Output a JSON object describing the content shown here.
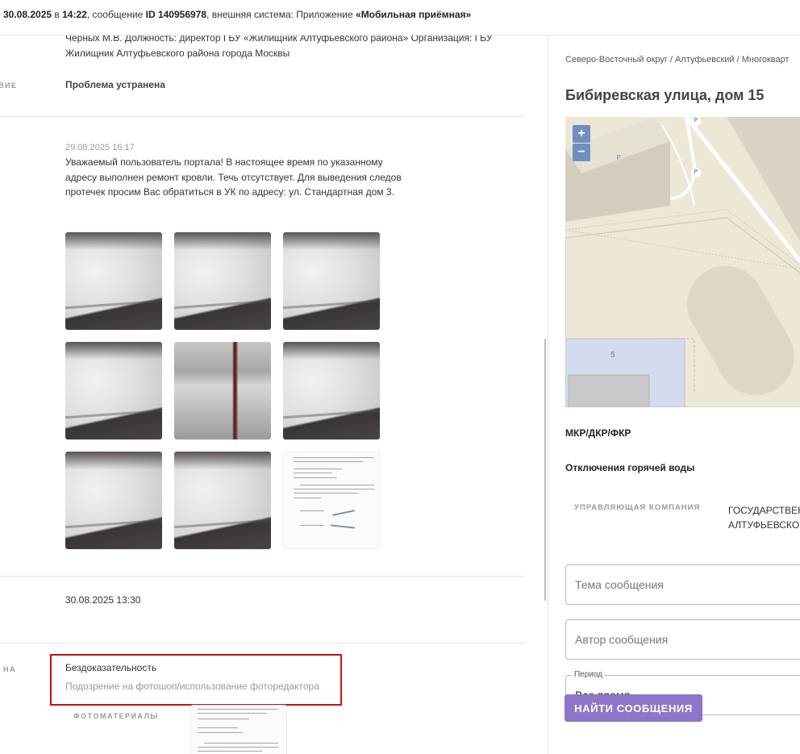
{
  "header": {
    "date": "30.08.2025",
    "in_word": "в",
    "time": "14:22",
    "message_prefix": ", сообщение",
    "id_label": "ID 140956978",
    "system_text": ", внешняя система: Приложение",
    "system_name": "«Мобильная приёмная»"
  },
  "left": {
    "responsible_text": "Черных М.В. Должность: директор ГБУ «Жилищник Алтуфьевского района» Организация: ГБУ Жилищник Алтуфьевского района города Москвы",
    "state_label": "ВИЕ",
    "state_value": "Проблема устранена",
    "answer_datetime": "29.08.2025 16:17",
    "answer_text": "Уважаемый пользователь портала! В настоящее время по указанному адресу выполнен ремонт кровли. Течь отсутствует. Для выведения следов протечек просим Вас обратиться в УК по адресу: ул. Стандартная дом 3.",
    "photos": [
      {
        "kind": "snow"
      },
      {
        "kind": "snow"
      },
      {
        "kind": "snow"
      },
      {
        "kind": "snow"
      },
      {
        "kind": "tower"
      },
      {
        "kind": "snow"
      },
      {
        "kind": "snow"
      },
      {
        "kind": "snow"
      },
      {
        "kind": "document"
      }
    ],
    "second_datetime": "30.08.2025 13:30",
    "reason_label": "НА",
    "reason_title": "Бездоказательность",
    "reason_detail": "Подозрение на фотошоп/использование фоторедактора",
    "photo_materials_label": "ФОТОМАТЕРИАЛЫ"
  },
  "right": {
    "breadcrumb": "Северо-Восточный округ / Алтуфьевский / Многокварт",
    "address": "Бибиревская улица, дом 15",
    "map": {
      "zoom_in": "+",
      "zoom_out": "−",
      "building_number": "5",
      "poi_marker": "P"
    },
    "mkr_title": "МКР/ДКР/ФКР",
    "hot_water_title": "Отключения горячей воды",
    "uk_label": "УПРАВЛЯЮЩАЯ КОМПАНИЯ",
    "uk_value_line1": "ГОСУДАРСТВЕН",
    "uk_value_line2": "АЛТУФЬЕВСКОГ",
    "topic_placeholder": "Тема сообщения",
    "author_placeholder": "Автор сообщения",
    "period_label": "Период",
    "period_value": "Все время",
    "find_button": "НАЙТИ СООБЩЕНИЯ"
  }
}
